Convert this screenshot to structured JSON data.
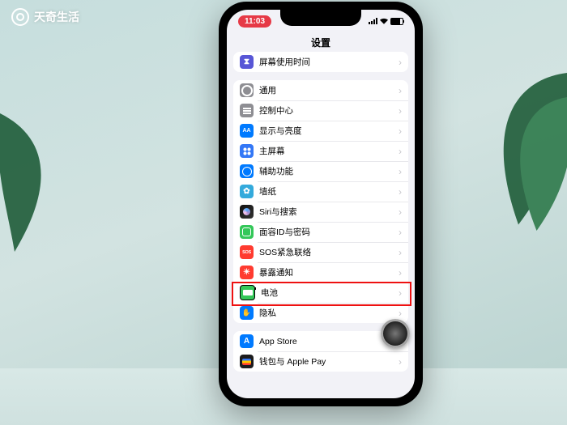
{
  "watermark": "天奇生活",
  "status": {
    "time": "11:03"
  },
  "navbar": {
    "title": "设置"
  },
  "groups": [
    {
      "rows": [
        {
          "icon": "hourglass",
          "color": "c-purple",
          "label": "屏幕使用时间"
        }
      ]
    },
    {
      "rows": [
        {
          "icon": "gear",
          "color": "c-grey",
          "label": "通用"
        },
        {
          "icon": "sliders",
          "color": "c-grey",
          "label": "控制中心"
        },
        {
          "icon": "aa",
          "color": "c-blue",
          "label": "显示与亮度"
        },
        {
          "icon": "grid4",
          "color": "c-bluel",
          "label": "主屏幕"
        },
        {
          "icon": "access",
          "color": "c-blue",
          "label": "辅助功能"
        },
        {
          "icon": "flower",
          "color": "c-wall",
          "label": "墙纸"
        },
        {
          "icon": "siri",
          "color": "c-dark",
          "label": "Siri与搜索"
        },
        {
          "icon": "face",
          "color": "c-green",
          "label": "面容ID与密码"
        },
        {
          "icon": "sos",
          "color": "c-sosr",
          "label": "SOS紧急联络"
        },
        {
          "icon": "expose",
          "color": "c-redd",
          "label": "暴露通知"
        },
        {
          "icon": "batt",
          "color": "c-green",
          "label": "电池",
          "highlighted": true
        },
        {
          "icon": "hand",
          "color": "c-blue",
          "label": "隐私"
        }
      ]
    },
    {
      "rows": [
        {
          "icon": "ashop",
          "color": "c-blue",
          "label": "App Store"
        },
        {
          "icon": "wallet",
          "color": "c-black",
          "label": "钱包与 Apple Pay"
        }
      ]
    }
  ]
}
